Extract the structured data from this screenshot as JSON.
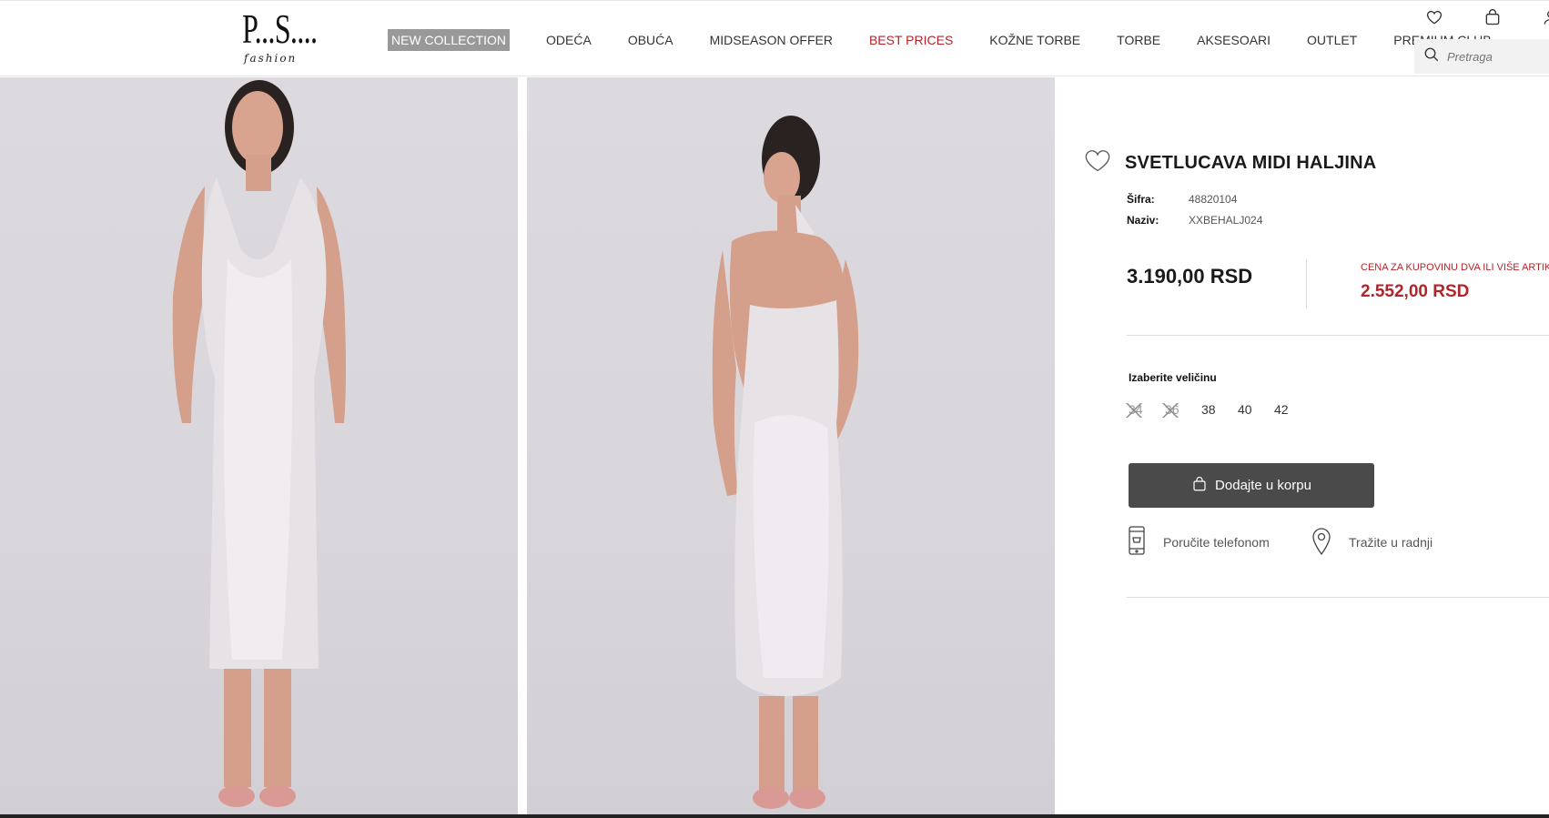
{
  "header": {
    "logo_text": "P...S....",
    "logo_sub": "fashion",
    "nav": [
      {
        "label": "NEW COLLECTION"
      },
      {
        "label": "ODEĆA"
      },
      {
        "label": "OBUĆA"
      },
      {
        "label": "MIDSEASON OFFER"
      },
      {
        "label": "BEST PRICES"
      },
      {
        "label": "KOŽNE TORBE"
      },
      {
        "label": "TORBE"
      },
      {
        "label": "AKSESOARI"
      },
      {
        "label": "OUTLET"
      },
      {
        "label": "PREMIUM CLUB"
      }
    ],
    "icons": [
      "heart-icon",
      "bag-icon",
      "user-icon"
    ],
    "search": {
      "placeholder": "Pretraga"
    }
  },
  "product": {
    "title": "SVETLUCAVA MIDI HALJINA",
    "sifra_label": "Šifra:",
    "sifra_value": "48820104",
    "naziv_label": "Naziv:",
    "naziv_value": "XXBEHALJ024",
    "price": "3.190,00 RSD",
    "promo_label": "CENA ZA KUPOVINU DVA ILI VIŠE ARTIKA",
    "promo_price": "2.552,00 RSD",
    "size_label": "Izaberite veličinu",
    "sizes": [
      {
        "label": "34",
        "available": false
      },
      {
        "label": "36",
        "available": false
      },
      {
        "label": "38",
        "available": true
      },
      {
        "label": "40",
        "available": true
      },
      {
        "label": "42",
        "available": true
      }
    ],
    "add_to_cart": "Dodajte u korpu",
    "order_phone": "Poručite telefonom",
    "find_store": "Tražite u radnji"
  },
  "colors": {
    "accent_red": "#b3232a",
    "button_dark": "#4a4a4a",
    "nav_active_bg": "#999999"
  }
}
